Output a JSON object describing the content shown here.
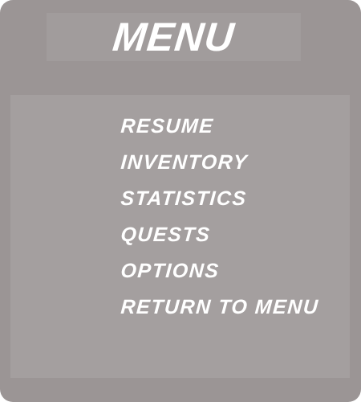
{
  "menu": {
    "title": "MENU",
    "items": [
      {
        "label": "RESUME"
      },
      {
        "label": "INVENTORY"
      },
      {
        "label": "STATISTICS"
      },
      {
        "label": "QUESTS"
      },
      {
        "label": "OPTIONS"
      },
      {
        "label": "RETURN TO MENU"
      }
    ]
  }
}
